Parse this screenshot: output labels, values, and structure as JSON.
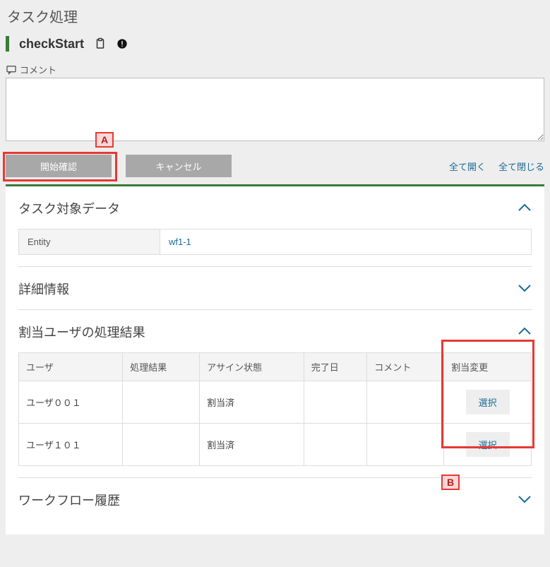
{
  "page_title": "タスク処理",
  "task_name": "checkStart",
  "comment": {
    "label": "コメント",
    "value": ""
  },
  "actions": {
    "confirm_label": "開始確認",
    "cancel_label": "キャンセル",
    "expand_all": "全て開く",
    "collapse_all": "全て閉じる"
  },
  "callouts": {
    "a": "A",
    "b": "B"
  },
  "sections": {
    "target": {
      "title": "タスク対象データ",
      "key": "Entity",
      "value": "wf1-1"
    },
    "detail": {
      "title": "詳細情報"
    },
    "results": {
      "title": "割当ユーザの処理結果",
      "headers": {
        "user": "ユーザ",
        "result": "処理結果",
        "assign_state": "アサイン状態",
        "complete_date": "完了日",
        "comment": "コメント",
        "reassign": "割当変更"
      },
      "rows": [
        {
          "user": "ユーザ００１",
          "result": "",
          "assign_state": "割当済",
          "complete_date": "",
          "comment": "",
          "action": "選択"
        },
        {
          "user": "ユーザ１０１",
          "result": "",
          "assign_state": "割当済",
          "complete_date": "",
          "comment": "",
          "action": "選択"
        }
      ]
    },
    "history": {
      "title": "ワークフロー履歴"
    }
  }
}
